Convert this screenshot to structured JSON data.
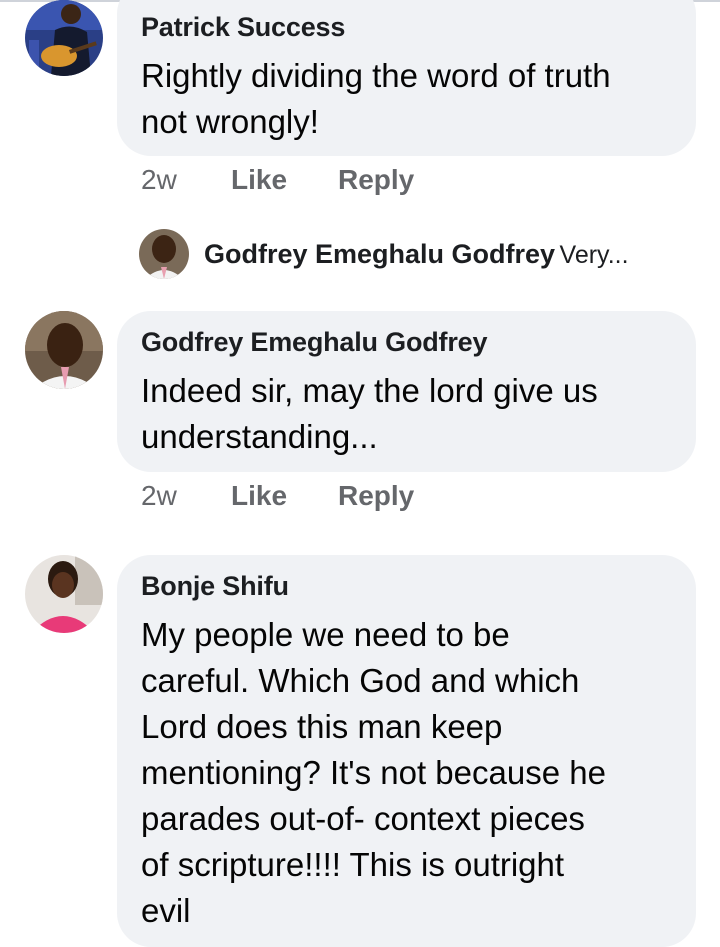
{
  "comments": [
    {
      "author": "Patrick Success",
      "text_lines": [
        "Rightly dividing the word of truth",
        "not wrongly!"
      ],
      "time": "2w",
      "like_label": "Like",
      "reply_label": "Reply",
      "reply_preview": {
        "author": "Godfrey Emeghalu Godfrey",
        "snippet": "Very..."
      }
    },
    {
      "author": "Godfrey Emeghalu Godfrey",
      "text_lines": [
        "Indeed sir, may the lord give us",
        "understanding..."
      ],
      "time": "2w",
      "like_label": "Like",
      "reply_label": "Reply"
    },
    {
      "author": "Bonje Shifu",
      "text_lines": [
        "My people we need to be",
        "careful. Which God and which",
        "Lord does this man keep",
        "mentioning? It's not because he",
        "parades out-of- context pieces",
        "of scripture!!!! This is outright",
        "evil"
      ]
    }
  ],
  "colors": {
    "bubble": "#f0f2f5",
    "author_text": "#1c1e21",
    "meta_text": "#65676b"
  }
}
